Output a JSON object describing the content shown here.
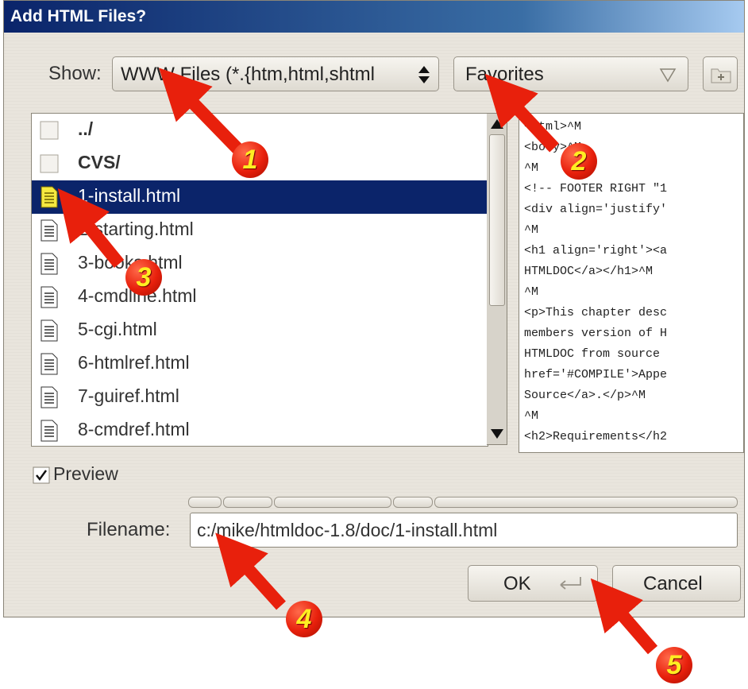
{
  "window": {
    "title": "Add HTML Files?"
  },
  "show": {
    "label": "Show:",
    "filter_value": "WWW Files (*.{htm,html,shtml"
  },
  "favorites": {
    "label": "Favorites"
  },
  "files": [
    {
      "name": "../",
      "type": "folder",
      "selected": false
    },
    {
      "name": "CVS/",
      "type": "folder",
      "selected": false
    },
    {
      "name": "1-install.html",
      "type": "file",
      "selected": true
    },
    {
      "name": "2-starting.html",
      "type": "file",
      "selected": false
    },
    {
      "name": "3-books.html",
      "type": "file",
      "selected": false
    },
    {
      "name": "4-cmdline.html",
      "type": "file",
      "selected": false
    },
    {
      "name": "5-cgi.html",
      "type": "file",
      "selected": false
    },
    {
      "name": "6-htmlref.html",
      "type": "file",
      "selected": false
    },
    {
      "name": "7-guiref.html",
      "type": "file",
      "selected": false
    },
    {
      "name": "8-cmdref.html",
      "type": "file",
      "selected": false
    }
  ],
  "preview_lines": [
    "<html>^M",
    "<body>^M",
    "^M",
    "<!-- FOOTER RIGHT \"1",
    "<div align='justify'",
    "^M",
    "<h1 align='right'><a",
    "HTMLDOC</a></h1>^M",
    "^M",
    "<p>This chapter desc",
    "members version of H",
    "HTMLDOC from source",
    "href='#COMPILE'>Appe",
    "Source</a>.</p>^M",
    "^M",
    "<h2>Requirements</h2"
  ],
  "preview_toggle": {
    "label": "Preview",
    "checked": true
  },
  "filename": {
    "label": "Filename:",
    "value": "c:/mike/htmldoc-1.8/doc/1-install.html"
  },
  "buttons": {
    "ok": "OK",
    "cancel": "Cancel"
  },
  "annotations": [
    "1",
    "2",
    "3",
    "4",
    "5"
  ],
  "colors": {
    "arrow": "#e8200c",
    "badge_text": "#ffee22",
    "selection": "#0b246a",
    "titlebar": "#0a246a"
  },
  "icons": {
    "new_folder": "folder-plus-icon",
    "file": "document-icon",
    "folder": "folder-icon",
    "enter": "return-key-icon"
  }
}
